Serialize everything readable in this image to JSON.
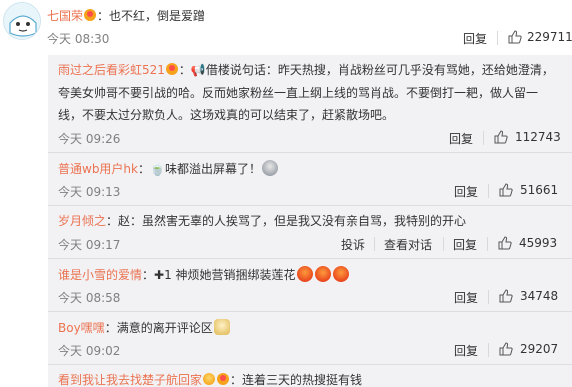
{
  "top_comment": {
    "username": "七国荣",
    "text": "：也不红，倒是爱蹭",
    "time": "今天 08:30",
    "reply_label": "回复",
    "likes": "229711"
  },
  "replies": [
    {
      "username": "雨过之后看彩虹521",
      "text_line1": "：📢借楼说句话：昨天热搜，肖战粉丝可几乎没有骂她，还给她澄清，",
      "text_line2": "夸美女帅哥不要引战的哈。反而她家粉丝一直上纲上线的骂肖战。不要倒打一耙，做人留一",
      "text_line3": "线，不要太过分欺负人。这场戏真的可以结束了，赶紧散场吧。",
      "time": "今天 09:26",
      "reply_label": "回复",
      "likes": "112743"
    },
    {
      "username": "普通wb用户hk",
      "text": "：🍵味都溢出屏幕了！",
      "time": "今天 09:13",
      "reply_label": "回复",
      "likes": "51661"
    },
    {
      "username": "岁月倾之",
      "text": "：赵：虽然害无辜的人挨骂了，但是我又没有亲自骂，我特别的开心",
      "time": "今天 09:17",
      "report_label": "投诉",
      "view_convo_label": "查看对话",
      "reply_label": "回复",
      "likes": "45993"
    },
    {
      "username": "谁是小雪的爱情",
      "text": "：✚1 神烦她营销捆绑装莲花",
      "time": "今天 08:58",
      "reply_label": "回复",
      "likes": "34748"
    },
    {
      "username": "Boy嘿嘿",
      "text": "：满意的离开评论区",
      "time": "今天 09:02",
      "reply_label": "回复",
      "likes": "29207"
    },
    {
      "username": "看到我让我去找楚子航回家",
      "text": "：连着三天的热搜挺有钱"
    }
  ],
  "colors": {
    "username": "#eb7350",
    "panel_bg": "#f2f2f5",
    "divider": "#dedede"
  },
  "icons": [
    "avatar",
    "vip-badge-icon",
    "thumb-up-icon",
    "emoji-icon"
  ]
}
